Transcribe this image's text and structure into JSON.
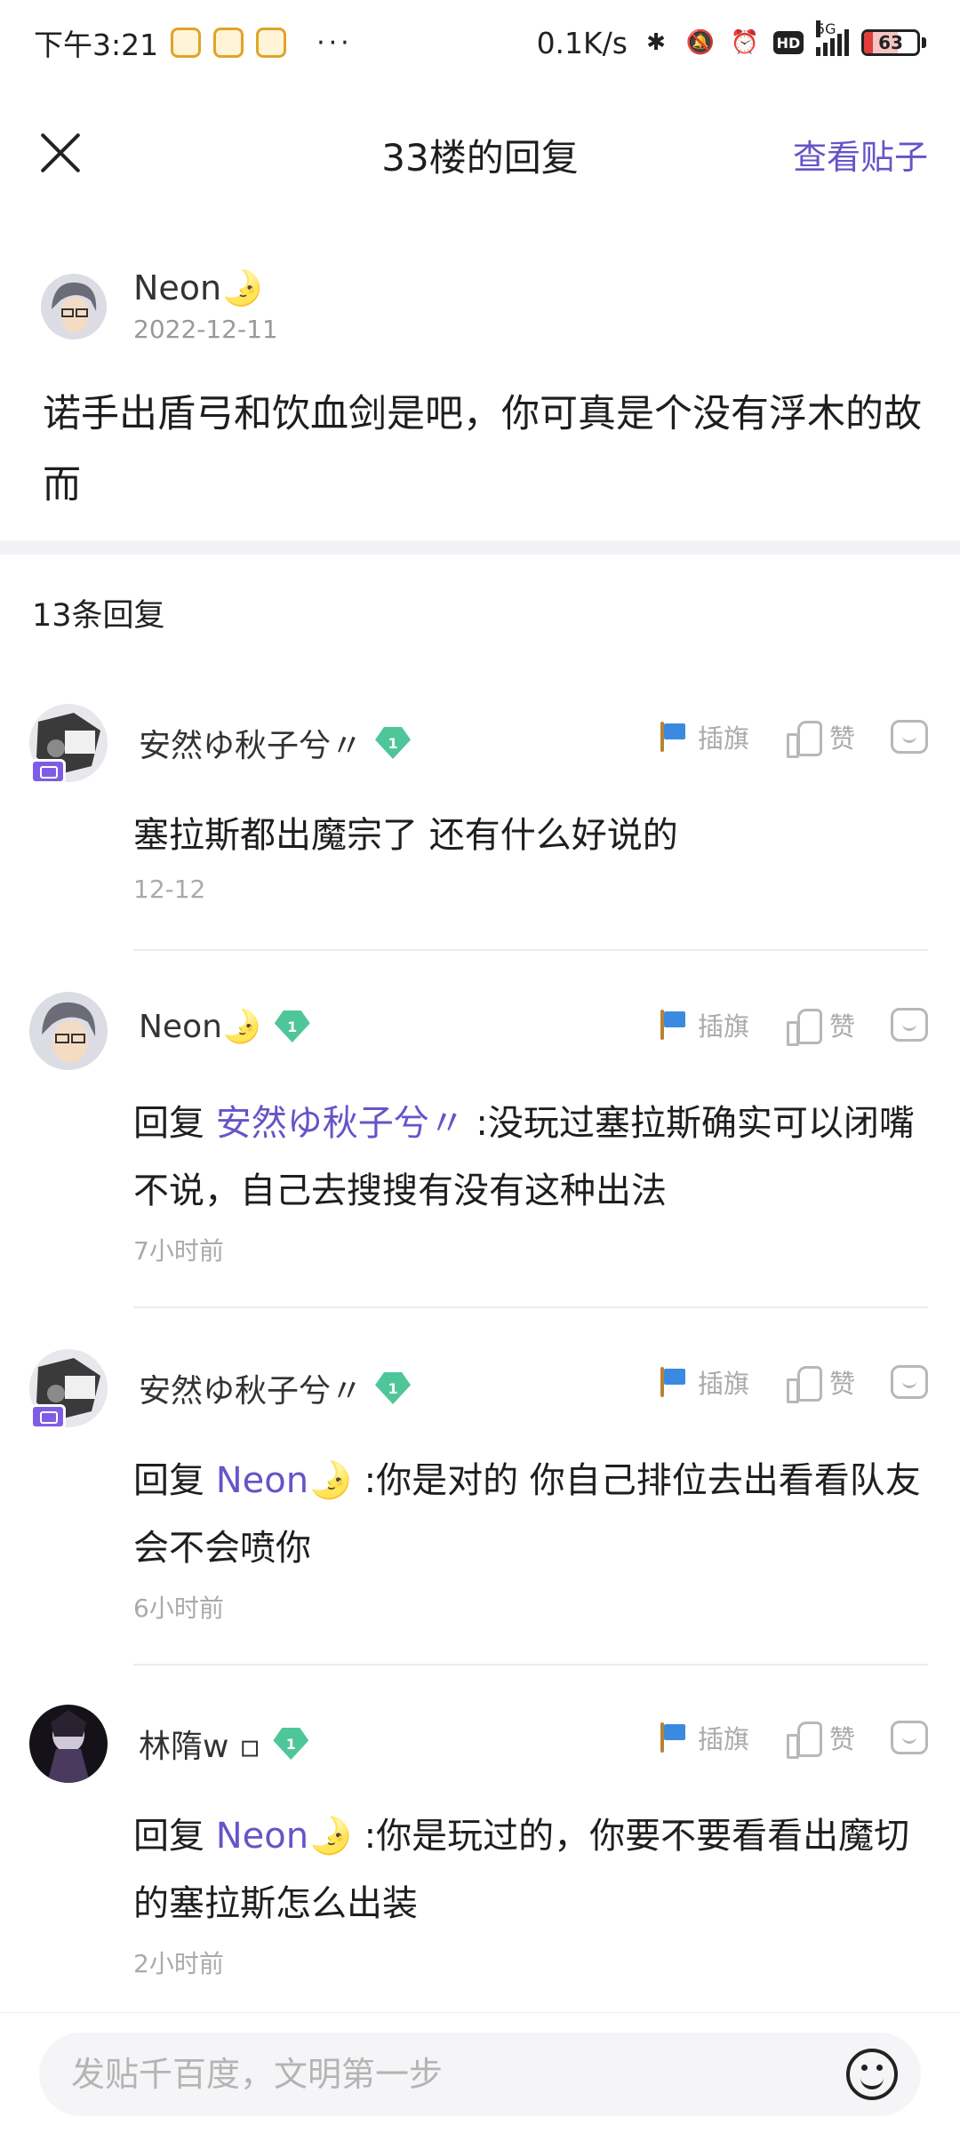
{
  "status_bar": {
    "time": "下午3:21",
    "more": "···",
    "speed": "0.1K/s",
    "network": "5G",
    "hd": "HD",
    "battery": "63",
    "battery_level": 0.63
  },
  "header": {
    "title": "33楼的回复",
    "view_post": "查看贴子"
  },
  "main_post": {
    "author": "Neon🌛",
    "date": "2022-12-11",
    "content": "诺手出盾弓和饮血剑是吧，你可真是个没有浮木的故而"
  },
  "reply_count": "13条回复",
  "actions": {
    "flag": "插旗",
    "like": "赞"
  },
  "replies": [
    {
      "author": "安然ゆ秋子兮〃",
      "level": "1",
      "content": "塞拉斯都出魔宗了 还有什么好说的",
      "time": "12-12"
    },
    {
      "author": "Neon🌛",
      "level": "1",
      "reply_prefix": "回复",
      "mention": "安然ゆ秋子兮〃",
      "content": " :没玩过塞拉斯确实可以闭嘴不说，自己去搜搜有没有这种出法",
      "time": "7小时前"
    },
    {
      "author": "安然ゆ秋子兮〃",
      "level": "1",
      "reply_prefix": "回复",
      "mention": "Neon🌛",
      "content": " :你是对的 你自己排位去出看看队友会不会喷你",
      "time": "6小时前"
    },
    {
      "author": "林隋w ▫",
      "level": "1",
      "reply_prefix": "回复",
      "mention": "Neon🌛",
      "content": " :你是玩过的，你要不要看看出魔切的塞拉斯怎么出装",
      "time": "2小时前"
    }
  ],
  "input": {
    "placeholder": "发贴千百度，文明第一步"
  }
}
